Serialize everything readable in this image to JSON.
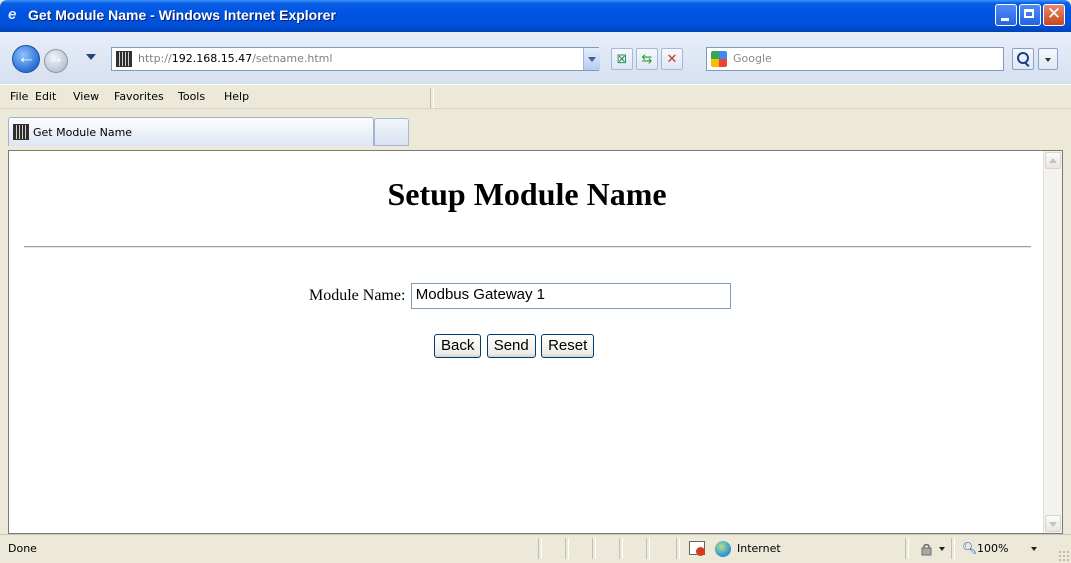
{
  "window": {
    "title": "Get Module Name - Windows Internet Explorer"
  },
  "navbar": {
    "url_prefix": "http://",
    "url_host": "192.168.15.47",
    "url_path": "/setname.html",
    "search_placeholder": "Google"
  },
  "menubar": {
    "items": [
      "File",
      "Edit",
      "View",
      "Favorites",
      "Tools",
      "Help"
    ]
  },
  "tabs": [
    {
      "label": "Get Module Name"
    }
  ],
  "page": {
    "heading": "Setup Module Name",
    "field_label": "Module Name:",
    "field_value": "Modbus Gateway 1",
    "buttons": [
      "Back",
      "Send",
      "Reset"
    ]
  },
  "statusbar": {
    "status": "Done",
    "zone": "Internet",
    "zoom": "100%"
  }
}
